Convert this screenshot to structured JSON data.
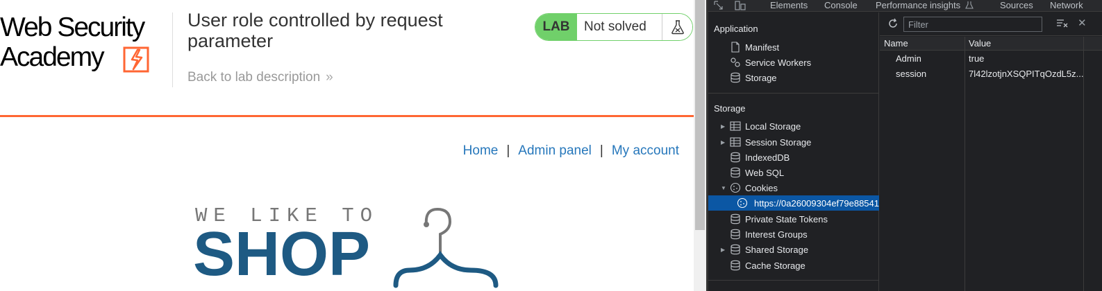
{
  "page": {
    "logo": {
      "line1": "Web Security",
      "line2": "Academy"
    },
    "lab_title": "User role controlled by request parameter",
    "back_link": "Back to lab description",
    "back_chevron": "»",
    "lab_badge": {
      "label": "LAB",
      "status": "Not solved"
    },
    "nav": {
      "home": "Home",
      "separator": "|",
      "admin_panel": "Admin panel",
      "my_account": "My account"
    },
    "shop_tagline": "WE LIKE TO",
    "shop_word": "SHOP",
    "colors": {
      "orange": "#ff6633",
      "link_blue": "#2677bb",
      "lab_green": "#70d06a",
      "shop_blue": "#1e5a83"
    }
  },
  "devtools": {
    "tabs": {
      "elements": "Elements",
      "console": "Console",
      "performance": "Performance insights",
      "sources": "Sources",
      "network": "Network"
    },
    "sidebar": {
      "application_heading": "Application",
      "application_items": [
        {
          "label": "Manifest",
          "icon": "document-icon"
        },
        {
          "label": "Service Workers",
          "icon": "gears-icon"
        },
        {
          "label": "Storage",
          "icon": "database-icon"
        }
      ],
      "storage_heading": "Storage",
      "storage_items": [
        {
          "label": "Local Storage",
          "icon": "table-icon",
          "expandable": true
        },
        {
          "label": "Session Storage",
          "icon": "table-icon",
          "expandable": true
        },
        {
          "label": "IndexedDB",
          "icon": "database-icon"
        },
        {
          "label": "Web SQL",
          "icon": "database-icon"
        },
        {
          "label": "Cookies",
          "icon": "cookie-icon",
          "expanded": true
        },
        {
          "label": "https://0a26009304ef79e88541",
          "icon": "cookie-icon",
          "selected": true
        },
        {
          "label": "Private State Tokens",
          "icon": "database-icon"
        },
        {
          "label": "Interest Groups",
          "icon": "database-icon"
        },
        {
          "label": "Shared Storage",
          "icon": "database-icon",
          "expandable": true
        },
        {
          "label": "Cache Storage",
          "icon": "database-icon"
        }
      ]
    },
    "filter": {
      "placeholder": "Filter"
    },
    "table": {
      "headers": {
        "name": "Name",
        "value": "Value"
      },
      "rows": [
        {
          "name": "Admin",
          "value": "true"
        },
        {
          "name": "session",
          "value": "7l42lzotjnXSQPITqOzdL5z..."
        }
      ]
    }
  }
}
